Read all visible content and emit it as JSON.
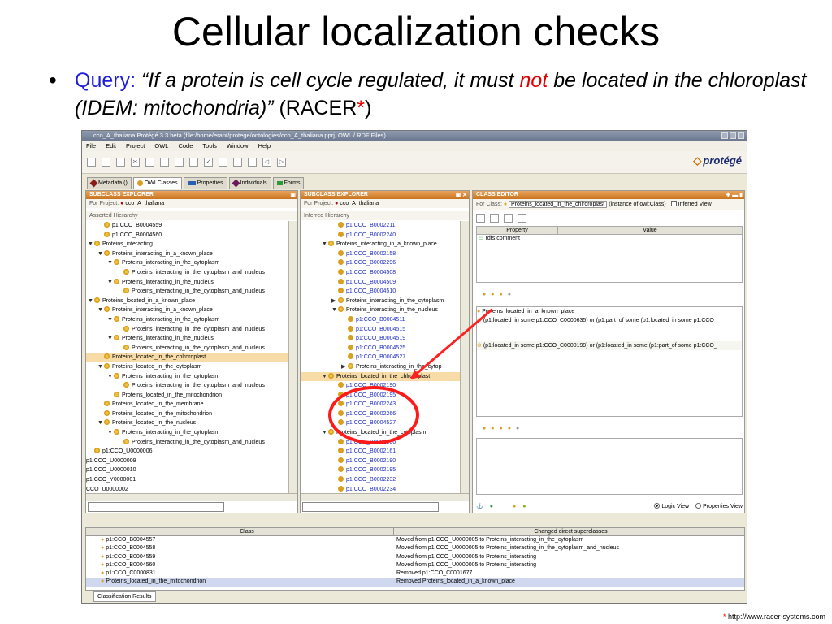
{
  "slide": {
    "title": "Cellular localization checks",
    "bullet": "•",
    "query_label": "Query:",
    "query_quote_a": "“If a protein is cell cycle regulated, it must",
    "query_not": "not",
    "query_quote_b": "be located in the chloroplast (IDEM: mitochondria)”",
    "racer": "(RACER",
    "racer_star": "*",
    "racer_close": ")",
    "footnote_star": "*",
    "footnote_url": "http://www.racer-systems.com"
  },
  "window": {
    "title": "cco_A_thaliana  Protégé 3.3 beta   (file:/home/erant/protege/ontologies/cco_A_thaliana.pprj, OWL / RDF Files)",
    "menu": [
      "File",
      "Edit",
      "Project",
      "OWL",
      "Code",
      "Tools",
      "Window",
      "Help"
    ],
    "logo": "protégé",
    "tabs": [
      "Metadata ()",
      "OWLClasses",
      "Properties",
      "Individuals",
      "Forms"
    ],
    "colors": {
      "accent": "#d8a020",
      "header": "#d88a3a",
      "arrow": "#ff2020"
    }
  },
  "left_panel": {
    "title": "SUBCLASS EXPLORER",
    "project_label": "For Project:",
    "project_value": "cco_A_thaliana",
    "section": "Asserted Hierarchy",
    "items": [
      {
        "text": "p1:CCO_B0004559",
        "indent": 1,
        "arrow": "",
        "blue": false,
        "sel": false
      },
      {
        "text": "p1:CCO_B0004560",
        "indent": 1,
        "arrow": "",
        "blue": false,
        "sel": false
      },
      {
        "text": "Proteins_interacting",
        "indent": 0,
        "arrow": "▼",
        "blue": false,
        "sel": false
      },
      {
        "text": "Proteins_interacting_in_a_known_place",
        "indent": 1,
        "arrow": "▼",
        "blue": false,
        "sel": false
      },
      {
        "text": "Proteins_interacting_in_the_cytoplasm",
        "indent": 2,
        "arrow": "▼",
        "blue": false,
        "sel": false
      },
      {
        "text": "Proteins_interacting_in_the_cytoplasm_and_nucleus",
        "indent": 3,
        "arrow": "",
        "blue": false,
        "sel": false
      },
      {
        "text": "Proteins_interacting_in_the_nucleus",
        "indent": 2,
        "arrow": "▼",
        "blue": false,
        "sel": false
      },
      {
        "text": "Proteins_interacting_in_the_cytoplasm_and_nucleus",
        "indent": 3,
        "arrow": "",
        "blue": false,
        "sel": false
      },
      {
        "text": "Proteins_located_in_a_known_place",
        "indent": 0,
        "arrow": "▼",
        "blue": false,
        "sel": false
      },
      {
        "text": "Proteins_interacting_in_a_known_place",
        "indent": 1,
        "arrow": "▼",
        "blue": false,
        "sel": false
      },
      {
        "text": "Proteins_interacting_in_the_cytoplasm",
        "indent": 2,
        "arrow": "▼",
        "blue": false,
        "sel": false
      },
      {
        "text": "Proteins_interacting_in_the_cytoplasm_and_nucleus",
        "indent": 3,
        "arrow": "",
        "blue": false,
        "sel": false
      },
      {
        "text": "Proteins_interacting_in_the_nucleus",
        "indent": 2,
        "arrow": "▼",
        "blue": false,
        "sel": false
      },
      {
        "text": "Proteins_interacting_in_the_cytoplasm_and_nucleus",
        "indent": 3,
        "arrow": "",
        "blue": false,
        "sel": false
      },
      {
        "text": "Proteins_located_in_the_chlroroplast",
        "indent": 1,
        "arrow": "",
        "blue": false,
        "sel": true
      },
      {
        "text": "Proteins_located_in_the_cytoplasm",
        "indent": 1,
        "arrow": "▼",
        "blue": false,
        "sel": false
      },
      {
        "text": "Proteins_interacting_in_the_cytoplasm",
        "indent": 2,
        "arrow": "▼",
        "blue": false,
        "sel": false
      },
      {
        "text": "Proteins_interacting_in_the_cytoplasm_and_nucleus",
        "indent": 3,
        "arrow": "",
        "blue": false,
        "sel": false
      },
      {
        "text": "Proteins_located_in_the_mitochondrion",
        "indent": 2,
        "arrow": "",
        "blue": false,
        "sel": false
      },
      {
        "text": "Proteins_located_in_the_membrane",
        "indent": 1,
        "arrow": "",
        "blue": false,
        "sel": false
      },
      {
        "text": "Proteins_located_in_the_mitochondrion",
        "indent": 1,
        "arrow": "",
        "blue": false,
        "sel": false
      },
      {
        "text": "Proteins_located_in_the_nucleus",
        "indent": 1,
        "arrow": "▼",
        "blue": false,
        "sel": false
      },
      {
        "text": "Proteins_interacting_in_the_cytoplasm",
        "indent": 2,
        "arrow": "▼",
        "blue": false,
        "sel": false
      },
      {
        "text": "Proteins_interacting_in_the_cytoplasm_and_nucleus",
        "indent": 3,
        "arrow": "",
        "blue": false,
        "sel": false
      },
      {
        "text": "p1:CCO_U0000006",
        "indent": 0,
        "arrow": "",
        "blue": false,
        "sel": false
      },
      {
        "text": "p1:CCO_U0000009",
        "indent": -1,
        "arrow": "",
        "blue": false,
        "sel": false
      },
      {
        "text": "p1:CCO_U0000010",
        "indent": -1,
        "arrow": "",
        "blue": false,
        "sel": false
      },
      {
        "text": "p1:CCO_Y0000001",
        "indent": -1,
        "arrow": "",
        "blue": false,
        "sel": false
      },
      {
        "text": "CCO_U0000002",
        "indent": -1,
        "arrow": "",
        "blue": false,
        "sel": false
      }
    ]
  },
  "mid_panel": {
    "title": "SUBCLASS EXPLORER",
    "project_label": "For Project:",
    "project_value": "cco_A_thaliana",
    "section": "Inferred Hierarchy",
    "items": [
      {
        "text": "p1:CCO_B0002211",
        "indent": 3,
        "arrow": "",
        "blue": true,
        "sel": false
      },
      {
        "text": "p1:CCO_B0002240",
        "indent": 3,
        "arrow": "",
        "blue": true,
        "sel": false
      },
      {
        "text": "Proteins_interacting_in_a_known_place",
        "indent": 2,
        "arrow": "▼",
        "blue": false,
        "sel": false
      },
      {
        "text": "p1:CCO_B0002158",
        "indent": 3,
        "arrow": "",
        "blue": true,
        "sel": false
      },
      {
        "text": "p1:CCO_B0002296",
        "indent": 3,
        "arrow": "",
        "blue": true,
        "sel": false
      },
      {
        "text": "p1:CCO_B0004508",
        "indent": 3,
        "arrow": "",
        "blue": true,
        "sel": false
      },
      {
        "text": "p1:CCO_B0004509",
        "indent": 3,
        "arrow": "",
        "blue": true,
        "sel": false
      },
      {
        "text": "p1:CCO_B0004510",
        "indent": 3,
        "arrow": "",
        "blue": true,
        "sel": false
      },
      {
        "text": "Proteins_interacting_in_the_cytoplasm",
        "indent": 3,
        "arrow": "▶",
        "blue": false,
        "sel": false
      },
      {
        "text": "Proteins_interacting_in_the_nucleus",
        "indent": 3,
        "arrow": "▼",
        "blue": false,
        "sel": false
      },
      {
        "text": "p1:CCO_B0004511",
        "indent": 4,
        "arrow": "",
        "blue": true,
        "sel": false
      },
      {
        "text": "p1:CCO_B0004515",
        "indent": 4,
        "arrow": "",
        "blue": true,
        "sel": false
      },
      {
        "text": "p1:CCO_B0004519",
        "indent": 4,
        "arrow": "",
        "blue": true,
        "sel": false
      },
      {
        "text": "p1:CCO_B0004525",
        "indent": 4,
        "arrow": "",
        "blue": true,
        "sel": false
      },
      {
        "text": "p1:CCO_B0004527",
        "indent": 4,
        "arrow": "",
        "blue": true,
        "sel": false
      },
      {
        "text": "Proteins_interacting_in_the_cytop",
        "indent": 4,
        "arrow": "▶",
        "blue": false,
        "sel": false
      },
      {
        "text": "Proteins_located_in_the_chlroroplast",
        "indent": 2,
        "arrow": "▼",
        "blue": false,
        "sel": true
      },
      {
        "text": "p1:CCO_B0002190",
        "indent": 3,
        "arrow": "",
        "blue": true,
        "sel": false
      },
      {
        "text": "p1:CCO_B0002195",
        "indent": 3,
        "arrow": "",
        "blue": true,
        "sel": false
      },
      {
        "text": "p1:CCO_B0002243",
        "indent": 3,
        "arrow": "",
        "blue": true,
        "sel": false
      },
      {
        "text": "p1:CCO_B0002266",
        "indent": 3,
        "arrow": "",
        "blue": true,
        "sel": false
      },
      {
        "text": "p1:CCO_B0004527",
        "indent": 3,
        "arrow": "",
        "blue": true,
        "sel": false
      },
      {
        "text": "Proteins_located_in_the_cytoplasm",
        "indent": 2,
        "arrow": "▼",
        "blue": false,
        "sel": false
      },
      {
        "text": "p1:CCO_B0002156",
        "indent": 3,
        "arrow": "",
        "blue": true,
        "sel": false
      },
      {
        "text": "p1:CCO_B0002161",
        "indent": 3,
        "arrow": "",
        "blue": true,
        "sel": false
      },
      {
        "text": "p1:CCO_B0002190",
        "indent": 3,
        "arrow": "",
        "blue": true,
        "sel": false
      },
      {
        "text": "p1:CCO_B0002195",
        "indent": 3,
        "arrow": "",
        "blue": true,
        "sel": false
      },
      {
        "text": "p1:CCO_B0002232",
        "indent": 3,
        "arrow": "",
        "blue": true,
        "sel": false
      },
      {
        "text": "p1:CCO_B0002234",
        "indent": 3,
        "arrow": "",
        "blue": true,
        "sel": false
      }
    ]
  },
  "class_editor": {
    "title": "CLASS EDITOR",
    "for_class_label": "For Class:",
    "class_name": "Proteins_located_in_the_chlroroplast",
    "instance_of": "(instance of owl:Class)",
    "inferred_view": "Inferred View",
    "col_property": "Property",
    "col_value": "Value",
    "property_row": "rdfs:comment",
    "sup1": "Proteins_located_in_a_known_place",
    "cond1": "(p1:located_in some p1:CCO_C0000635) or (p1:part_of some (p1:located_in some p1:CCO_",
    "cond2": "(p1:located_in some p1:CCO_C0000199) or (p1:located_in some (p1:part_of some p1:CCO_",
    "logic_view": "Logic View",
    "properties_view": "Properties View"
  },
  "results": {
    "col_class": "Class",
    "col_changed": "Changed direct superclasses",
    "rows": [
      {
        "cls": "p1:CCO_B0004557",
        "chg": "Moved from p1:CCO_U0000005 to Proteins_interacting_in_the_cytoplasm",
        "sel": false
      },
      {
        "cls": "p1:CCO_B0004558",
        "chg": "Moved from p1:CCO_U0000005 to Proteins_interacting_in_the_cytoplasm_and_nucleus",
        "sel": false
      },
      {
        "cls": "p1:CCO_B0004559",
        "chg": "Moved from p1:CCO_U0000005 to Proteins_interacting",
        "sel": false
      },
      {
        "cls": "p1:CCO_B0004560",
        "chg": "Moved from p1:CCO_U0000005 to Proteins_interacting",
        "sel": false
      },
      {
        "cls": "p1:CCO_C0000831",
        "chg": "Removed p1:CCO_C0001677",
        "sel": false
      },
      {
        "cls": "Proteins_located_in_the_mitochondrion",
        "chg": "Removed Proteins_located_in_a_known_place",
        "sel": true
      }
    ],
    "tab": "Classification Results"
  }
}
